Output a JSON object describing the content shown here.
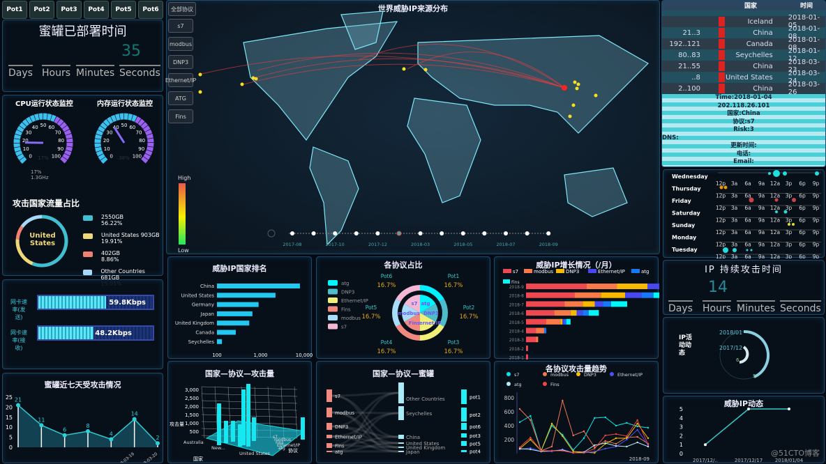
{
  "pots": [
    "Pot1",
    "Pot2",
    "Pot3",
    "Pot4",
    "Pot5",
    "Pot6"
  ],
  "deploy": {
    "title": "蜜罐已部署时间",
    "units": [
      "Days",
      "Hours",
      "Minutes",
      "Seconds"
    ],
    "seconds": "35"
  },
  "gauges": {
    "cpu_title": "CPU运行状态监控",
    "mem_title": "内存运行状态监控",
    "cpu_value": 17,
    "mem_value": 38,
    "cpu_label": "17%",
    "mem_label": "38%",
    "ticks": [
      "0",
      "10",
      "20",
      "30",
      "40",
      "50",
      "60",
      "70",
      "80",
      "90",
      "100"
    ],
    "cpu_info": [
      "17%",
      "1.3GHz"
    ]
  },
  "country_share": {
    "title": "攻击国家流量占比",
    "center": "United States",
    "items": [
      {
        "label": "2550GB",
        "pct": "56.22%",
        "color": "#3fbfcf"
      },
      {
        "label": "United States 903GB",
        "pct": "19.91%",
        "color": "#f0d878"
      },
      {
        "label": "402GB",
        "pct": "8.86%",
        "color": "#f08070"
      },
      {
        "label": "Other Countries 681GB",
        "pct": "15.01%",
        "color": "#a8d8f8"
      }
    ]
  },
  "netcard": {
    "send_label": "网卡速率(发送)",
    "recv_label": "网卡速率(接收)",
    "send_value": "59.8Kbps",
    "recv_value": "48.2Kbps",
    "send_fill": 0.59,
    "recv_fill": 0.48
  },
  "map": {
    "title": "世界威胁IP来源分布",
    "filter_button": "全部协议",
    "protocol_buttons": [
      "s7",
      "modbus",
      "DNP3",
      "Ethernet/IP",
      "ATG",
      "Fins"
    ],
    "legend_high": "High",
    "legend_low": "Low",
    "timeline": [
      "2017-08",
      "2017-10",
      "2017-12",
      "2018-03",
      "2018-05",
      "2018-07",
      "2018-09"
    ]
  },
  "table": {
    "headers": [
      "国家",
      "时间"
    ],
    "rows": [
      {
        "ip": "",
        "country": "Iceland",
        "time": "2018-01-05"
      },
      {
        "ip": "21..3",
        "country": "China",
        "time": "2018-01-08"
      },
      {
        "ip": "192..121",
        "country": "Canada",
        "time": "2018-01-08"
      },
      {
        "ip": "80..83",
        "country": "Seychelles",
        "time": "2018-01-12"
      },
      {
        "ip": "21..55",
        "country": "China",
        "time": "2018-03-23"
      },
      {
        "ip": "..8",
        "country": "United States",
        "time": "2018-03-24"
      },
      {
        "ip": "2..100",
        "country": "China",
        "time": "2018-03-26"
      }
    ],
    "detail": [
      "Time:2018-01-04",
      "202.118.26.101",
      "国家:China",
      "协议:s7",
      "Risk:3",
      "DNS:",
      "更新时间:",
      "电话:",
      "Email:"
    ]
  },
  "heatmap": {
    "days": [
      "Wednesday",
      "Thursday",
      "Friday",
      "Saturday",
      "Sunday",
      "Monday",
      "Tuesday"
    ],
    "hours": [
      "12p",
      "3a",
      "6a",
      "9a",
      "12a",
      "3p",
      "6p",
      "9p"
    ]
  },
  "ip_duration": {
    "title": "IP 持续攻击时间",
    "hours": "14",
    "units": [
      "Days",
      "Hours",
      "Minutes",
      "Seconds"
    ]
  },
  "ip_activity": {
    "title": "IP活动动态",
    "labels": [
      "2018/01",
      "2017/12"
    ],
    "values": [
      "6",
      "5"
    ]
  },
  "chart_data": [
    {
      "type": "line",
      "id": "seven_day",
      "title": "蜜罐近七天受攻击情况",
      "values": [
        21,
        11,
        6,
        8,
        4,
        14,
        2
      ],
      "ylim": [
        0,
        25
      ],
      "yticks": [
        0,
        5,
        10,
        15,
        20,
        25
      ],
      "categories": [
        "",
        "",
        "",
        "",
        "",
        "2018-03-19",
        "2018-03-20"
      ]
    },
    {
      "type": "bar",
      "id": "country_rank",
      "title": "威胁IP国家排名",
      "categories": [
        "China",
        "United States",
        "Germany",
        "Japan",
        "United Kingdom",
        "Canada",
        "Seychelles"
      ],
      "values": [
        8000,
        2200,
        900,
        650,
        550,
        270,
        130
      ],
      "xscale": "log",
      "xticks": [
        "100",
        "1,000",
        "10,000"
      ]
    },
    {
      "type": "pie",
      "id": "protocol_share",
      "title": "各协议占比",
      "inner": [
        {
          "name": "atg",
          "value": 1,
          "color": "#00f5ff"
        },
        {
          "name": "DNP3",
          "value": 1,
          "color": "#4fbccc"
        },
        {
          "name": "Ethernet/IP",
          "value": 1,
          "color": "#f0f078"
        },
        {
          "name": "Fins",
          "value": 1,
          "color": "#f08a80"
        },
        {
          "name": "modbus",
          "value": 1,
          "color": "#a8dcf8"
        },
        {
          "name": "s7",
          "value": 1,
          "color": "#f4b8d4"
        }
      ],
      "outer": [
        {
          "name": "Pot1",
          "pct": "16.7%"
        },
        {
          "name": "Pot2",
          "pct": "16.7%"
        },
        {
          "name": "Pot3",
          "pct": "16.7%"
        },
        {
          "name": "Pot4",
          "pct": "16.7%"
        },
        {
          "name": "Pot5",
          "pct": "16.7%"
        },
        {
          "name": "Pot6",
          "pct": "16.7%"
        }
      ]
    },
    {
      "type": "bar",
      "id": "ip_growth",
      "title": "威胁IP增长情况（/月）",
      "stacked": true,
      "categories": [
        "2018-9",
        "2018-8",
        "2018-7",
        "2018-6",
        "2018-5",
        "2018-4",
        "2018-3",
        "2018-2",
        "2018-1"
      ],
      "series": [
        {
          "name": "s7",
          "color": "#f04850",
          "values": [
            30,
            24,
            19,
            14,
            10,
            5,
            5,
            1,
            1
          ]
        },
        {
          "name": "modbus",
          "color": "#f87a48",
          "values": [
            15,
            13,
            9,
            8,
            7,
            4,
            1,
            0,
            0
          ]
        },
        {
          "name": "DNP3",
          "color": "#f8b800",
          "values": [
            15,
            12,
            6,
            3,
            1,
            0,
            0,
            0,
            0
          ]
        },
        {
          "name": "Ethernet/IP",
          "color": "#4848f0",
          "values": [
            10,
            8,
            4,
            3,
            1,
            0,
            0,
            0,
            0
          ]
        },
        {
          "name": "atg",
          "color": "#1878f8",
          "values": [
            8,
            6,
            4,
            3,
            1,
            1,
            0,
            0,
            0
          ]
        },
        {
          "name": "Fins",
          "color": "#00f8f8",
          "values": [
            17,
            15,
            8,
            5,
            2,
            0,
            0,
            0,
            0
          ]
        }
      ]
    },
    {
      "type": "line",
      "id": "protocol_trend",
      "title": "各协议攻击量趋势",
      "ylim": [
        0,
        800
      ],
      "yticks": [
        200,
        400,
        600,
        800
      ],
      "xlabel_last": "2018-09",
      "series": [
        {
          "name": "s7",
          "color": "#00e8e8",
          "values": [
            450,
            540,
            40,
            400,
            270,
            50,
            220,
            510,
            520,
            400,
            440,
            390,
            370
          ]
        },
        {
          "name": "modbus",
          "color": "#f07850",
          "values": [
            640,
            480,
            40,
            100,
            760,
            260,
            320,
            90,
            180,
            140,
            230,
            240,
            140
          ]
        },
        {
          "name": "DNP3",
          "color": "#f8c000",
          "values": [
            70,
            200,
            40,
            430,
            250,
            30,
            20,
            10,
            140,
            220,
            220,
            430,
            220
          ]
        },
        {
          "name": "Ethernet/IP",
          "color": "#5050f0",
          "values": [
            60,
            80,
            30,
            30,
            60,
            10,
            10,
            30,
            70,
            100,
            200,
            340,
            120
          ]
        },
        {
          "name": "atg",
          "color": "#b8e8f8",
          "values": [
            70,
            60,
            30,
            40,
            50,
            10,
            20,
            120,
            150,
            110,
            100,
            160,
            100
          ]
        },
        {
          "name": "Fins",
          "color": "#f04848",
          "values": [
            90,
            230,
            40,
            40,
            40,
            10,
            10,
            70,
            260,
            280,
            250,
            480,
            130
          ]
        }
      ]
    },
    {
      "type": "line",
      "id": "threat_ip_dynamic",
      "title": "威胁IP动态",
      "categories": [
        "2017/12/..",
        "2017/12/17",
        "2018/01/04"
      ],
      "values": [
        1,
        5,
        5
      ],
      "ylim": [
        0,
        5
      ],
      "yticks": [
        0,
        1,
        2,
        3,
        4,
        5
      ]
    }
  ],
  "bar3d": {
    "title": "国家—协议—攻击量",
    "yticks": [
      "3,000",
      "2,500",
      "2,000",
      "1,500",
      "1,000",
      "500"
    ],
    "ylabel": "攻击量",
    "xlabel": "国家",
    "zlabel": "协议",
    "protocols": [
      "s7",
      "modbus",
      "Fins",
      "Ethernet/IP",
      "atg"
    ],
    "countries": [
      "Australia",
      "New...",
      "United States"
    ]
  },
  "sankey": {
    "title": "国家—协议—蜜罐",
    "left": [
      "s7",
      "modbus",
      "DNP3",
      "Ethernet/IP",
      "Fins",
      "atg"
    ],
    "middle": [
      "Other Countries",
      "Seychelles",
      "China",
      "United States",
      "United Kingdom",
      "Japan"
    ],
    "right": [
      "pot1",
      "pot2",
      "pot6",
      "pot3",
      "pot5",
      "pot4"
    ]
  },
  "watermark": "@51CTO博客"
}
